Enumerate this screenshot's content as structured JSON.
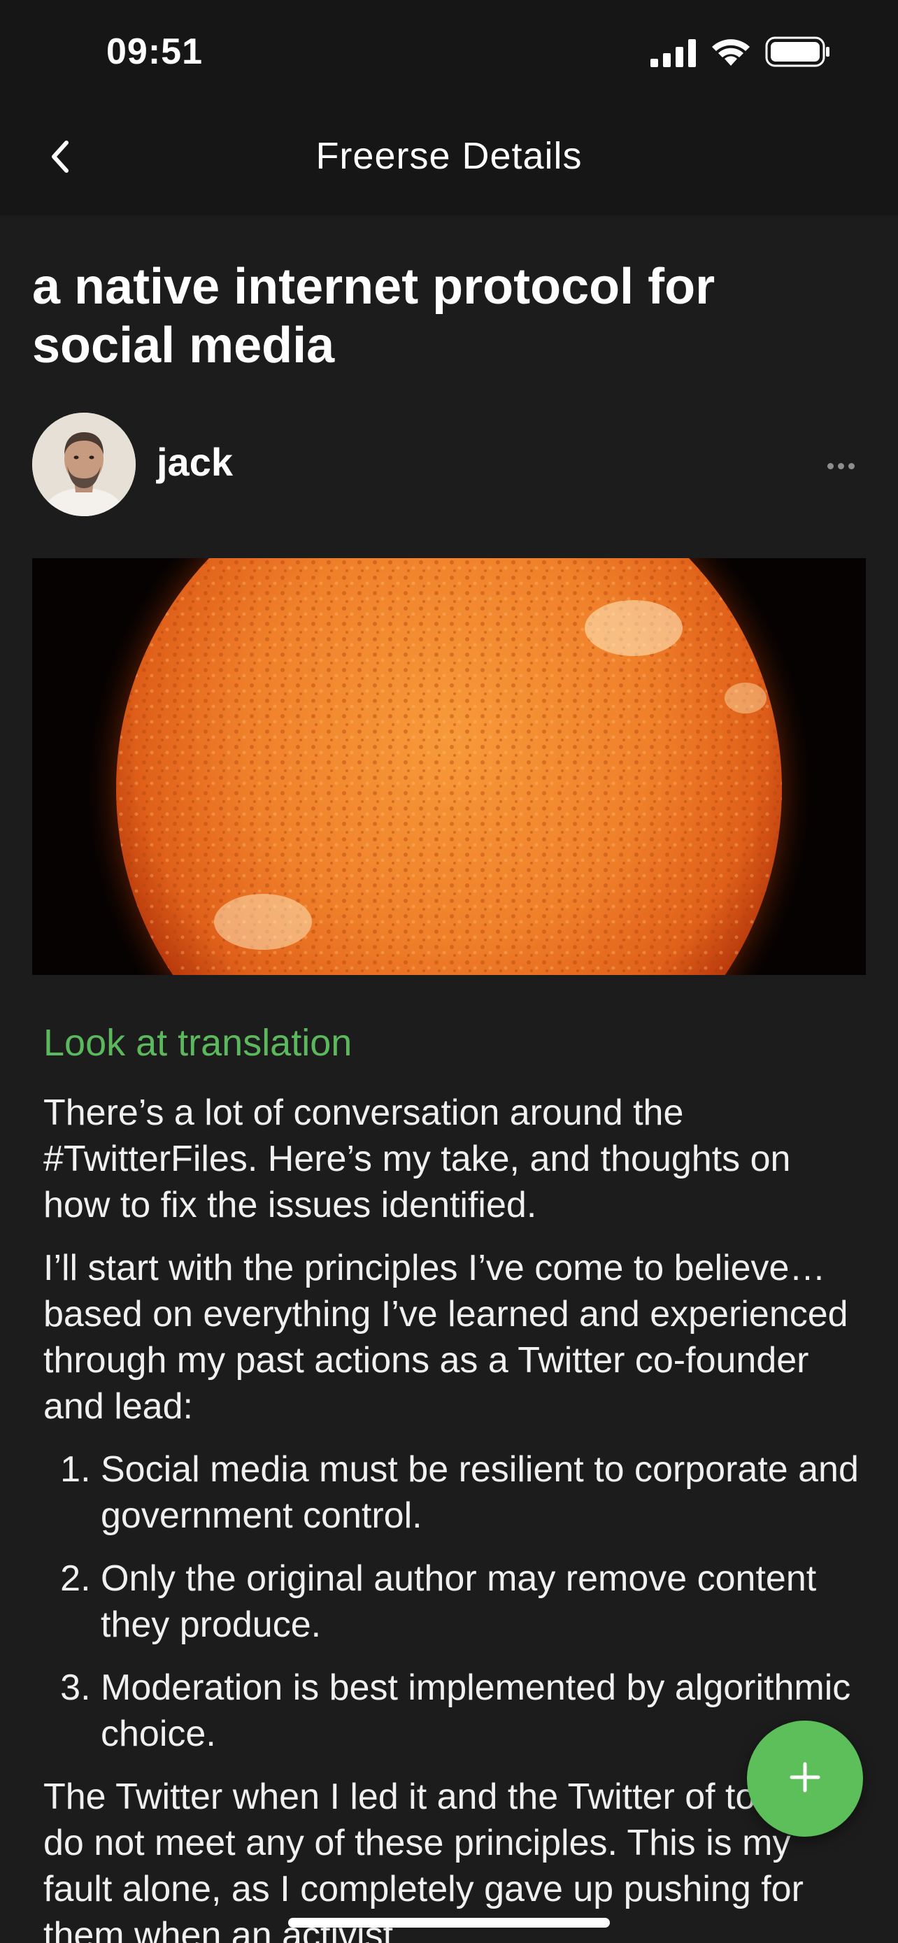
{
  "status_bar": {
    "time": "09:51",
    "icons": [
      "signal-icon",
      "wifi-icon",
      "battery-icon"
    ]
  },
  "nav": {
    "back_icon": "chevron-left-icon",
    "title": "Freerse Details"
  },
  "post": {
    "title": "a native internet protocol for social media",
    "author": "jack",
    "more_icon": "ellipsis-icon",
    "translation_link": "Look at translation",
    "paragraphs": [
      "There’s a lot of conversation around the #TwitterFiles. Here’s my take, and thoughts on how to fix the issues identified.",
      "I’ll start with the principles I’ve come to believe…based on everything I’ve learned and experienced through my past actions as a Twitter co-founder and lead:"
    ],
    "principles": [
      "Social media must be resilient to corporate and government control.",
      "Only the original author may remove content they produce.",
      "Moderation is best implemented by algorithmic choice."
    ],
    "closing_paragraph": "The Twitter when I led it and the Twitter of today do not meet any of these principles. This is my fault alone, as I completely gave up pushing for them when an activist"
  },
  "fab": {
    "icon": "plus-icon"
  },
  "colors": {
    "background": "#1c1c1d",
    "bar_background": "#161616",
    "accent_green": "#5cb85c",
    "fab_green": "#5cbf5a"
  }
}
